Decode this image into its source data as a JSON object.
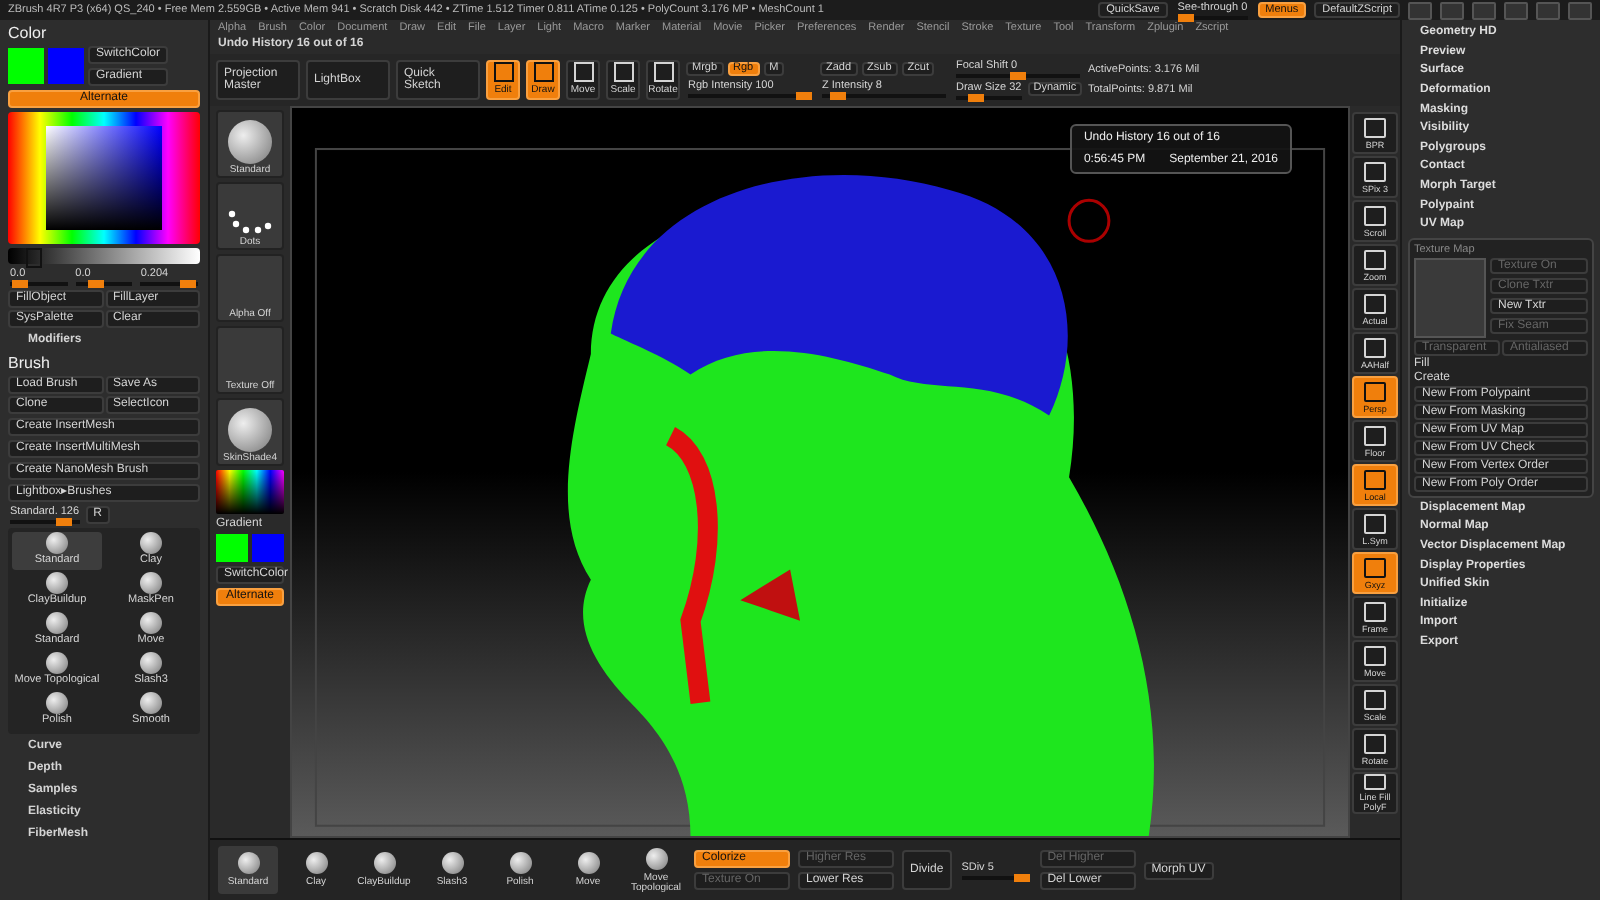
{
  "title_bar": {
    "info": "ZBrush 4R7 P3 (x64)   QS_240   • Free Mem 2.559GB • Active Mem 941 • Scratch Disk 442 • ZTime 1.512 Timer 0.811 ATime 0.125 • PolyCount 3.176 MP • MeshCount 1",
    "quicksave": "QuickSave",
    "see_through": {
      "label": "See-through 0",
      "level": 0
    },
    "menus": {
      "label": "Menus",
      "selected": true
    },
    "script": "DefaultZScript"
  },
  "menu_bar": [
    "Alpha",
    "Brush",
    "Color",
    "Document",
    "Draw",
    "Edit",
    "File",
    "Layer",
    "Light",
    "Macro",
    "Marker",
    "Material",
    "Movie",
    "Picker",
    "Preferences",
    "Render",
    "Stencil",
    "Stroke",
    "Texture",
    "Tool",
    "Transform",
    "Zplugin",
    "Zscript"
  ],
  "shelf": {
    "undo_label": "Undo History 16 out of 16",
    "buttons": [
      "Projection Master",
      "LightBox",
      "Quick Sketch"
    ],
    "modes": [
      {
        "label": "Edit",
        "selected": true
      },
      {
        "label": "Draw",
        "selected": true
      },
      {
        "label": "Move",
        "selected": false
      },
      {
        "label": "Scale",
        "selected": false
      },
      {
        "label": "Rotate",
        "selected": false
      }
    ],
    "rgb_modes": [
      {
        "label": "Mrgb",
        "selected": false
      },
      {
        "label": "Rgb",
        "selected": true
      },
      {
        "label": "M",
        "selected": false
      }
    ],
    "z_modes": [
      {
        "label": "Zadd",
        "selected": false
      },
      {
        "label": "Zsub",
        "selected": false
      },
      {
        "label": "Zcut",
        "selected": false
      }
    ],
    "sliders": [
      {
        "label": "Rgb Intensity 100",
        "level": 1
      },
      {
        "label": "Z Intensity 8",
        "level": 0.08
      },
      {
        "label": "Focal Shift 0",
        "level": 0.5
      },
      {
        "label": "Draw Size 32",
        "level": 0.25
      }
    ],
    "dynamic": "Dynamic",
    "stats": [
      "ActivePoints: 3.176 Mil",
      "TotalPoints: 9.871 Mil"
    ]
  },
  "left_panel": {
    "color_title": "Color",
    "swatches": [
      {
        "color": "#00ff00"
      },
      {
        "color": "#0000ff"
      }
    ],
    "switch_color": "SwitchColor",
    "gradient": "Gradient",
    "alternate": {
      "label": "Alternate",
      "selected": true
    },
    "value_slider": {
      "level": 0.1
    },
    "rgb_sliders": [
      {
        "label": "0.0",
        "level": 0.05
      },
      {
        "label": "0.0",
        "level": 0.3
      },
      {
        "label": "0.204",
        "level": 0.95
      }
    ],
    "fill_buttons": [
      "FillObject",
      "FillLayer",
      "SysPalette",
      "Clear"
    ],
    "modifiers": "Modifiers",
    "brush_title": "Brush",
    "brush_pairs": [
      "Load Brush",
      "Save As",
      "Clone",
      "SelectIcon"
    ],
    "brush_buttons": [
      "Create InsertMesh",
      "Create InsertMultiMesh",
      "Create NanoMesh Brush",
      "Lightbox▸Brushes"
    ],
    "brush_slider": {
      "label": "Standard. 126",
      "level": 0.85
    },
    "r_button": "R",
    "brushes": [
      {
        "label": "Standard",
        "selected": true
      },
      {
        "label": "Clay",
        "selected": false
      },
      {
        "label": "ClayBuildup",
        "selected": false
      },
      {
        "label": "MaskPen",
        "selected": false
      },
      {
        "label": "Standard",
        "selected": false
      },
      {
        "label": "Move",
        "selected": false
      },
      {
        "label": "Move Topological",
        "selected": false
      },
      {
        "label": "Slash3",
        "selected": false
      },
      {
        "label": "Polish",
        "selected": false
      },
      {
        "label": "Smooth",
        "selected": false
      }
    ],
    "sections": [
      "Curve",
      "Depth",
      "Samples",
      "Elasticity",
      "FiberMesh"
    ]
  },
  "tool_strip": {
    "thumbs": [
      {
        "kind": "brush",
        "label": "Standard"
      },
      {
        "kind": "stroke",
        "label": "Dots"
      },
      {
        "kind": "empty",
        "label": "Alpha Off"
      },
      {
        "kind": "empty",
        "label": "Texture Off"
      },
      {
        "kind": "material",
        "label": "SkinShade4"
      }
    ],
    "gradient": "Gradient",
    "swatches": [
      {
        "color": "#00ff00"
      },
      {
        "color": "#0000ff"
      }
    ],
    "switch_color": "SwitchColor",
    "alternate": {
      "label": "Alternate",
      "selected": true
    }
  },
  "viewport": {
    "undo_popup": {
      "title": "Undo History 16 out of 16",
      "time": "0:56:45 PM",
      "date": "September 21, 2016"
    }
  },
  "view_strip": [
    {
      "label": "BPR",
      "on": false
    },
    {
      "label": "SPix 3",
      "on": false
    },
    {
      "label": "Scroll",
      "on": false
    },
    {
      "label": "Zoom",
      "on": false
    },
    {
      "label": "Actual",
      "on": false
    },
    {
      "label": "AAHalf",
      "on": false
    },
    {
      "label": "Persp",
      "on": true
    },
    {
      "label": "Floor",
      "on": false
    },
    {
      "label": "Local",
      "on": true
    },
    {
      "label": "L.Sym",
      "on": false
    },
    {
      "label": "Gxyz",
      "on": true
    },
    {
      "label": "Frame",
      "on": false
    },
    {
      "label": "Move",
      "on": false
    },
    {
      "label": "Scale",
      "on": false
    },
    {
      "label": "Rotate",
      "on": false
    },
    {
      "label": "Line Fill PolyF",
      "on": false
    }
  ],
  "right_panel": {
    "items_before": [
      "Geometry HD",
      "Preview",
      "Surface",
      "Deformation",
      "Masking",
      "Visibility",
      "Polygroups",
      "Contact",
      "Morph Target",
      "Polypaint",
      "UV Map"
    ],
    "texture_map": {
      "title": "Texture Map",
      "buttons": [
        {
          "label": "Texture On",
          "disabled": true
        },
        {
          "label": "Clone Txtr",
          "disabled": true
        },
        {
          "label": "New Txtr",
          "disabled": false
        },
        {
          "label": "Fix Seam",
          "disabled": true
        }
      ],
      "toggles": [
        {
          "label": "Transparent",
          "disabled": true
        },
        {
          "label": "Antialiased",
          "disabled": true
        }
      ],
      "fill": "Fill",
      "create": "Create",
      "create_buttons": [
        "New From Polypaint",
        "New From Masking",
        "New From UV Map",
        "New From UV Check",
        "New From Vertex Order",
        "New From Poly Order"
      ]
    },
    "items_after": [
      "Displacement Map",
      "Normal Map",
      "Vector Displacement Map",
      "Display Properties",
      "Unified Skin",
      "Initialize",
      "Import",
      "Export"
    ]
  },
  "bottom_shelf": {
    "brushes": [
      {
        "label": "Standard",
        "selected": true
      },
      {
        "label": "Clay",
        "selected": false
      },
      {
        "label": "ClayBuildup",
        "selected": false
      },
      {
        "label": "Slash3",
        "selected": false
      },
      {
        "label": "Polish",
        "selected": false
      },
      {
        "label": "Move",
        "selected": false
      },
      {
        "label": "Move Topological",
        "selected": false
      }
    ],
    "buttons": [
      {
        "label": "Colorize",
        "selected": true,
        "disabled": false
      },
      {
        "label": "Texture On",
        "selected": false,
        "disabled": true
      },
      {
        "label": "Higher Res",
        "selected": false,
        "disabled": true
      },
      {
        "label": "Lower Res",
        "selected": false,
        "disabled": false
      },
      {
        "label": "Divide",
        "selected": false,
        "disabled": false
      }
    ],
    "sdiv": {
      "label": "SDiv 5",
      "level": 1
    },
    "del_buttons": [
      {
        "label": "Del Higher",
        "disabled": true
      },
      {
        "label": "Del Lower",
        "disabled": false
      }
    ],
    "morph": "Morph UV"
  }
}
